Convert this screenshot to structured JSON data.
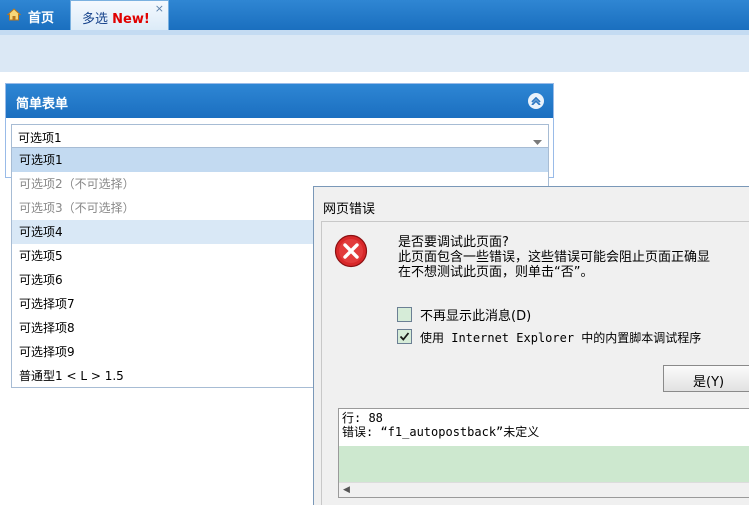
{
  "tabs": {
    "home": {
      "label": "首页",
      "icon": "home-icon"
    },
    "active": {
      "label": "多选",
      "badge": "New!",
      "close": "×"
    }
  },
  "panel": {
    "title": "简单表单",
    "combo": {
      "value": "可选项1"
    }
  },
  "dropdown": {
    "items": [
      {
        "label": "可选项1",
        "state": "selected"
      },
      {
        "label": "可选项2（不可选择）",
        "state": "disabled"
      },
      {
        "label": "可选项3（不可选择）",
        "state": "disabled"
      },
      {
        "label": "可选项4",
        "state": "hover"
      },
      {
        "label": "可选项5",
        "state": "normal"
      },
      {
        "label": "可选项6",
        "state": "normal"
      },
      {
        "label": "可选择项7",
        "state": "normal"
      },
      {
        "label": "可选择项8",
        "state": "normal"
      },
      {
        "label": "可选择项9",
        "state": "normal"
      },
      {
        "label": "普通型1 < L > 1.5",
        "state": "normal"
      }
    ]
  },
  "dialog": {
    "title": "网页错误",
    "icon": "error-icon",
    "message": [
      "是否要调试此页面?",
      "此页面包含一些错误，这些错误可能会阻止页面正确显",
      "在不想测试此页面，则单击“否”。"
    ],
    "checkbox1": {
      "label": "不再显示此消息(D)",
      "checked": false
    },
    "checkbox2": {
      "label": "使用 Internet Explorer 中的内置脚本调试程序",
      "checked": true
    },
    "yes_button": "是(Y)",
    "details": [
      "行: 88",
      "错误: “f1_autopostback”未定义"
    ]
  },
  "colors": {
    "header_blue": "#1b6fc0",
    "selected_row": "#c3daf1",
    "details_highlight": "#cde8cf"
  }
}
